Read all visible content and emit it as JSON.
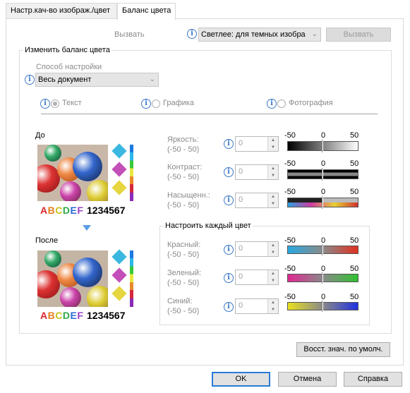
{
  "tabs": [
    {
      "label": "Настр.кач-во изображ./цвет"
    },
    {
      "label": "Баланс цвета"
    }
  ],
  "top": {
    "call_label": "Вызвать",
    "preset_combo": "Светлее: для темных изобра",
    "call_button": "Вызвать"
  },
  "balance_group": {
    "title": "Изменить баланс цвета",
    "method_label": "Способ настройки",
    "method_value": "Весь документ",
    "radios": [
      {
        "label": "Текст",
        "checked": true
      },
      {
        "label": "Графика",
        "checked": false
      },
      {
        "label": "Фотография",
        "checked": false
      }
    ],
    "before_label": "До",
    "after_label": "После",
    "sample_letters": "ABCDEF",
    "sample_digits": "1234567"
  },
  "adjust": {
    "scale_min": "-50",
    "scale_mid": "0",
    "scale_max": "50",
    "rows": [
      {
        "label": "Яркость:",
        "range": "(-50 - 50)",
        "value": "0"
      },
      {
        "label": "Контраст:",
        "range": "(-50 - 50)",
        "value": "0"
      },
      {
        "label": "Насыщенн.:",
        "range": "(-50 - 50)",
        "value": "0"
      }
    ]
  },
  "each_color": {
    "title": "Настроить каждый цвет",
    "rows": [
      {
        "label": "Красный:",
        "range": "(-50 - 50)",
        "value": "0"
      },
      {
        "label": "Зеленый:",
        "range": "(-50 - 50)",
        "value": "0"
      },
      {
        "label": "Синий:",
        "range": "(-50 - 50)",
        "value": "0"
      }
    ]
  },
  "reset_button": "Восст. знач. по умолч.",
  "footer": {
    "ok": "OK",
    "cancel": "Отмена",
    "help": "Справка"
  },
  "colors": {
    "accent": "#2a7ad6",
    "info_icon": "#3c79c8"
  }
}
